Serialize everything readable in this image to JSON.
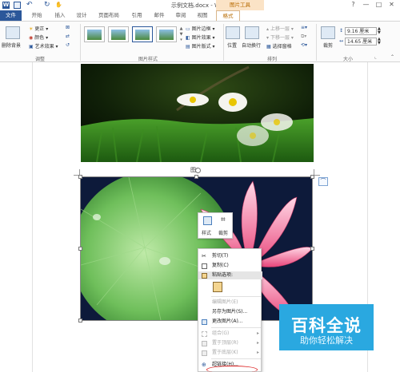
{
  "window": {
    "title": "示例文档.docx - Word",
    "context_group": "图片工具",
    "controls": [
      "?",
      "—",
      "□",
      "✕"
    ]
  },
  "tabs": [
    {
      "label": "文件",
      "active": false
    },
    {
      "label": "开始",
      "active": false
    },
    {
      "label": "插入",
      "active": false
    },
    {
      "label": "设计",
      "active": false
    },
    {
      "label": "页面布局",
      "active": false
    },
    {
      "label": "引用",
      "active": false
    },
    {
      "label": "邮件",
      "active": false
    },
    {
      "label": "审阅",
      "active": false
    },
    {
      "label": "视图",
      "active": false
    },
    {
      "label": "格式",
      "active": true
    }
  ],
  "ribbon": {
    "adjust": {
      "remove_bg": "删除背景",
      "correct": "更正",
      "color": "颜色",
      "artistic": "艺术效果",
      "label": "调整"
    },
    "styles": {
      "border": "图片边框",
      "effects": "图片效果",
      "layout": "图片版式",
      "label": "图片样式"
    },
    "arrange": {
      "position": "位置",
      "wrap": "自动换行",
      "bring_forward": "上移一层",
      "send_backward": "下移一层",
      "selection_pane": "选择窗格",
      "label": "排列"
    },
    "size": {
      "crop": "裁剪",
      "height": "9.16 厘米",
      "width": "14.65 厘米",
      "label": "大小"
    }
  },
  "document": {
    "caption": "图1"
  },
  "mini_toolbar": {
    "style": "样式",
    "crop": "裁剪"
  },
  "context_menu": [
    {
      "label": "剪切(T)",
      "icon": "scissors-icon",
      "disabled": false
    },
    {
      "label": "复制(C)",
      "icon": "copy-icon",
      "disabled": false
    },
    {
      "label": "粘贴选项:",
      "icon": "paste-icon",
      "disabled": false,
      "highlight": true
    },
    {
      "label": "",
      "icon": "paste-keep-icon",
      "disabled": false
    },
    {
      "label": "编辑图片(E)",
      "icon": "",
      "disabled": true
    },
    {
      "label": "另存为图片(S)...",
      "icon": "",
      "disabled": false
    },
    {
      "label": "更改图片(A)...",
      "icon": "change-picture-icon",
      "disabled": false
    },
    {
      "label": "组合(G)",
      "icon": "group-icon",
      "disabled": true,
      "submenu": true
    },
    {
      "label": "置于顶层(R)",
      "icon": "bring-front-icon",
      "disabled": true,
      "submenu": true
    },
    {
      "label": "置于底层(K)",
      "icon": "send-back-icon",
      "disabled": true,
      "submenu": true
    },
    {
      "label": "超链接(H)...",
      "icon": "hyperlink-icon",
      "disabled": false
    }
  ],
  "watermark": {
    "line1": "百科全说",
    "line2": "助你轻松解决"
  }
}
